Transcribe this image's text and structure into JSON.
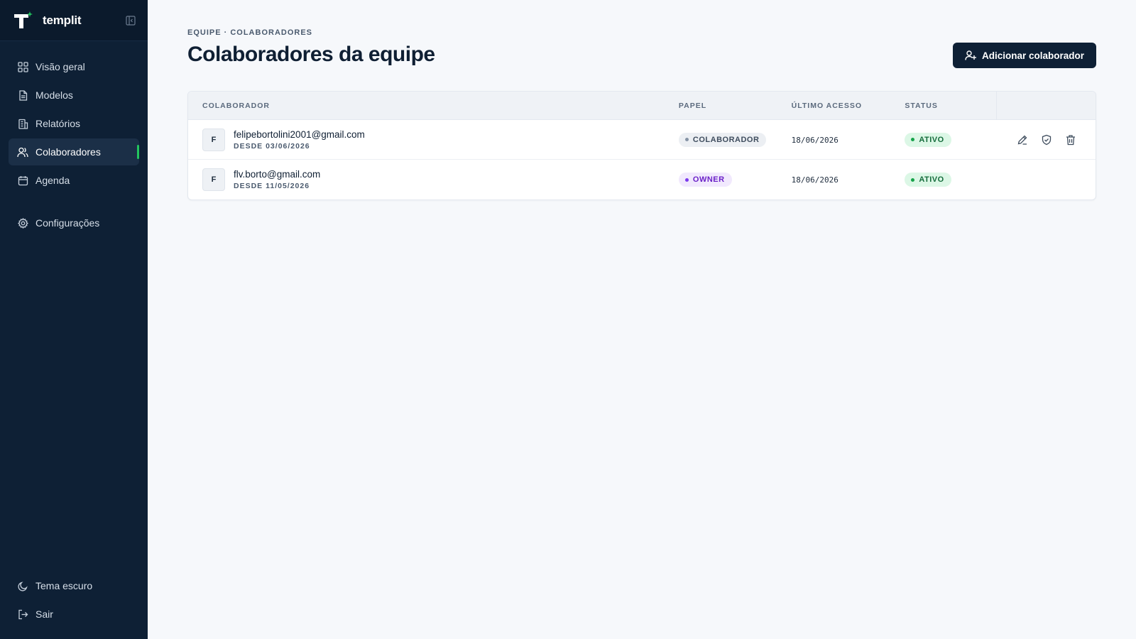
{
  "brand": {
    "name": "templit"
  },
  "sidebar": {
    "items": [
      {
        "label": "Visão geral",
        "icon": "grid-icon"
      },
      {
        "label": "Modelos",
        "icon": "document-icon"
      },
      {
        "label": "Relatórios",
        "icon": "building-icon"
      },
      {
        "label": "Colaboradores",
        "icon": "users-icon",
        "active": true
      },
      {
        "label": "Agenda",
        "icon": "calendar-icon"
      },
      {
        "label": "Configurações",
        "icon": "gear-icon"
      }
    ],
    "bottom": [
      {
        "label": "Tema escuro",
        "icon": "moon-icon"
      },
      {
        "label": "Sair",
        "icon": "logout-icon"
      }
    ]
  },
  "header": {
    "breadcrumb": "EQUIPE · COLABORADORES",
    "title": "Colaboradores da equipe",
    "add_button": "Adicionar colaborador"
  },
  "table": {
    "columns": [
      "COLABORADOR",
      "PAPEL",
      "ÚLTIMO ACESSO",
      "STATUS"
    ],
    "rows": [
      {
        "initial": "F",
        "email": "felipebortolini2001@gmail.com",
        "since": "DESDE 03/06/2026",
        "role": "COLABORADOR",
        "last_access": "18/06/2026",
        "status": "ATIVO"
      },
      {
        "initial": "F",
        "email": "flv.borto@gmail.com",
        "since": "DESDE 11/05/2026",
        "role": "OWNER",
        "last_access": "18/06/2026",
        "status": "ATIVO"
      }
    ]
  },
  "colors": {
    "sidebar_bg": "#0e2035",
    "accent_green": "#22c55e",
    "primary_button": "#0e2035",
    "owner_badge": "#7c3aed",
    "active_badge": "#16a34a"
  }
}
